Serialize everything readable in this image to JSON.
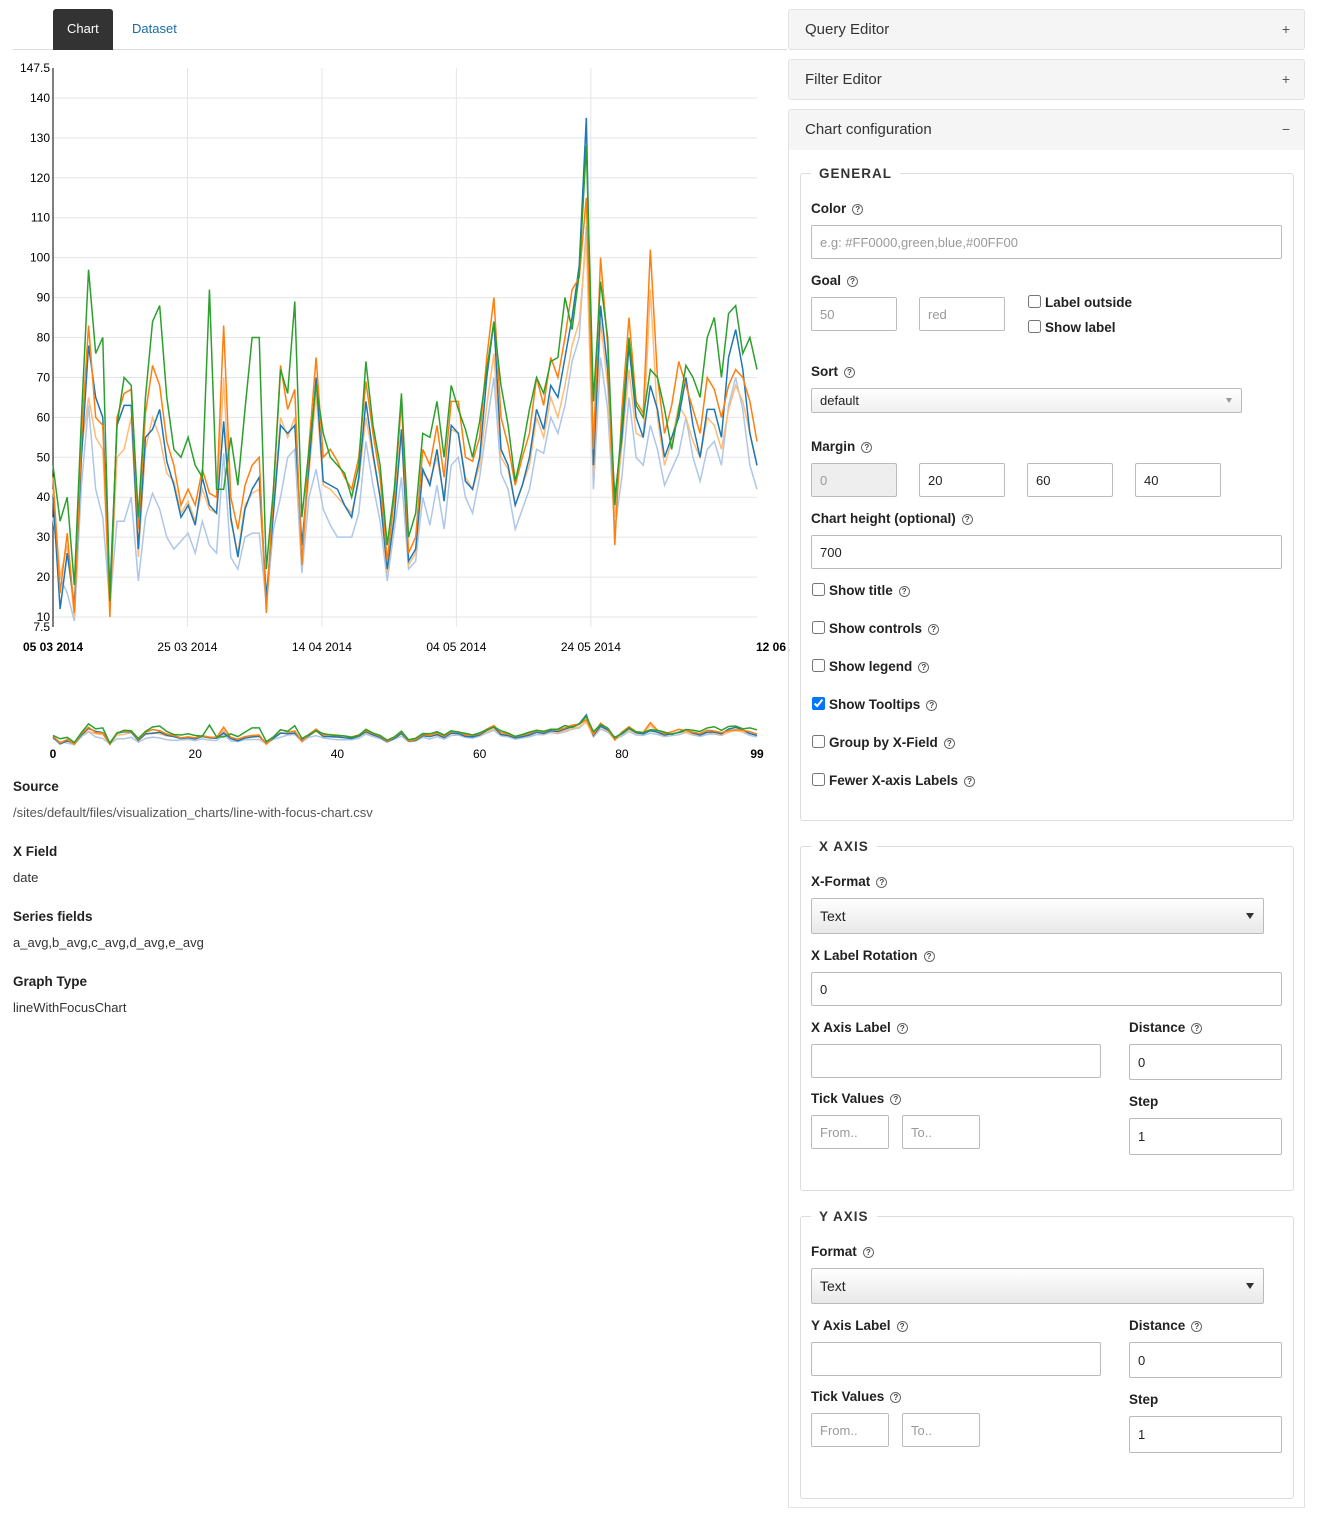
{
  "tabs": [
    {
      "label": "Chart"
    },
    {
      "label": "Dataset"
    }
  ],
  "chart_data": {
    "type": "line",
    "subtype": "lineWithFocusChart",
    "y_ticks": [
      "147.5",
      "140",
      "130",
      "120",
      "110",
      "100",
      "90",
      "80",
      "70",
      "60",
      "50",
      "40",
      "30",
      "20",
      "10",
      "7.5"
    ],
    "x_ticks": [
      "05 03 2014",
      "25 03 2014",
      "14 04 2014",
      "04 05 2014",
      "24 05 2014",
      "12 06 2014"
    ],
    "focus_x_ticks": [
      "0",
      "20",
      "40",
      "60",
      "80",
      "99"
    ],
    "ylim": [
      7.5,
      147.5
    ],
    "x_domain": [
      0,
      99
    ],
    "colors": [
      "#1f77b4",
      "#aec7e8",
      "#ff7f0e",
      "#ffbb78",
      "#2ca02c"
    ],
    "grid": true,
    "series": [
      {
        "values": [
          40,
          12,
          26,
          13,
          50,
          78,
          65,
          60,
          16,
          58,
          63,
          63,
          27,
          55,
          57,
          62,
          49,
          43,
          35,
          38,
          33,
          45,
          38,
          36,
          59,
          35,
          25,
          37,
          42,
          45,
          15,
          36,
          58,
          56,
          58,
          28,
          48,
          70,
          44,
          43,
          42,
          38,
          35,
          45,
          64,
          51,
          40,
          22,
          35,
          57,
          24,
          27,
          47,
          43,
          52,
          39,
          58,
          56,
          44,
          42,
          50,
          70,
          84,
          52,
          48,
          38,
          43,
          50,
          62,
          57,
          68,
          65,
          75,
          85,
          98,
          135,
          48,
          88,
          72,
          40,
          55,
          78,
          60,
          55,
          68,
          62,
          50,
          55,
          60,
          70,
          58,
          50,
          62,
          62,
          55,
          75,
          82,
          72,
          56,
          48
        ]
      },
      {
        "values": [
          35,
          20,
          16,
          9,
          43,
          63,
          42,
          35,
          13,
          34,
          34,
          40,
          19,
          35,
          41,
          37,
          30,
          27,
          29,
          31,
          26,
          34,
          28,
          26,
          51,
          25,
          22,
          30,
          31,
          31,
          13,
          32,
          40,
          50,
          52,
          21,
          40,
          47,
          37,
          33,
          30,
          30,
          30,
          36,
          54,
          43,
          34,
          19,
          32,
          45,
          22,
          24,
          40,
          33,
          43,
          32,
          48,
          50,
          40,
          36,
          45,
          58,
          70,
          46,
          42,
          32,
          37,
          42,
          52,
          51,
          60,
          56,
          63,
          74,
          80,
          108,
          42,
          75,
          62,
          32,
          45,
          65,
          50,
          48,
          58,
          52,
          43,
          47,
          51,
          60,
          50,
          44,
          52,
          54,
          48,
          63,
          70,
          62,
          48,
          42
        ]
      },
      {
        "values": [
          45,
          16,
          31,
          11,
          55,
          83,
          60,
          58,
          10,
          60,
          66,
          67,
          32,
          61,
          73,
          68,
          54,
          48,
          38,
          42,
          38,
          47,
          41,
          40,
          83,
          40,
          32,
          43,
          48,
          50,
          11,
          42,
          73,
          62,
          67,
          23,
          53,
          75,
          50,
          52,
          49,
          45,
          42,
          50,
          69,
          56,
          45,
          24,
          40,
          64,
          26,
          30,
          52,
          48,
          58,
          45,
          64,
          64,
          50,
          49,
          55,
          75,
          90,
          60,
          53,
          43,
          50,
          56,
          70,
          63,
          75,
          70,
          80,
          92,
          95,
          115,
          52,
          100,
          78,
          28,
          62,
          85,
          64,
          61,
          102,
          70,
          56,
          63,
          74,
          68,
          62,
          56,
          70,
          67,
          60,
          68,
          72,
          70,
          64,
          54
        ]
      },
      {
        "values": [
          42,
          20,
          28,
          10,
          52,
          65,
          55,
          52,
          12,
          50,
          52,
          60,
          25,
          52,
          60,
          55,
          46,
          44,
          36,
          39,
          34,
          42,
          37,
          36,
          70,
          34,
          26,
          38,
          41,
          42,
          13,
          38,
          60,
          55,
          60,
          24,
          46,
          66,
          43,
          42,
          40,
          38,
          36,
          44,
          60,
          50,
          40,
          21,
          36,
          56,
          23,
          26,
          46,
          44,
          50,
          40,
          57,
          56,
          45,
          42,
          48,
          63,
          76,
          50,
          47,
          38,
          43,
          48,
          60,
          55,
          65,
          60,
          68,
          78,
          84,
          105,
          46,
          84,
          68,
          35,
          53,
          72,
          56,
          55,
          92,
          60,
          48,
          54,
          63,
          60,
          54,
          50,
          60,
          58,
          52,
          62,
          68,
          64,
          56,
          48
        ]
      },
      {
        "values": [
          48,
          34,
          40,
          18,
          60,
          97,
          76,
          80,
          14,
          58,
          70,
          68,
          35,
          65,
          84,
          88,
          65,
          52,
          50,
          55,
          48,
          45,
          92,
          42,
          42,
          55,
          43,
          62,
          80,
          80,
          22,
          42,
          72,
          66,
          89,
          35,
          52,
          68,
          56,
          50,
          48,
          46,
          40,
          48,
          74,
          58,
          48,
          28,
          42,
          66,
          30,
          36,
          56,
          55,
          64,
          50,
          68,
          62,
          57,
          50,
          59,
          72,
          84,
          68,
          58,
          44,
          52,
          62,
          70,
          66,
          74,
          75,
          90,
          82,
          96,
          128,
          64,
          94,
          80,
          38,
          58,
          80,
          63,
          60,
          72,
          70,
          62,
          52,
          62,
          73,
          70,
          65,
          80,
          85,
          70,
          86,
          88,
          76,
          80,
          72
        ]
      }
    ]
  },
  "meta": {
    "source_label": "Source",
    "source_value": "/sites/default/files/visualization_charts/line-with-focus-chart.csv",
    "xfield_label": "X Field",
    "xfield_value": "date",
    "series_label": "Series fields",
    "series_value": "a_avg,b_avg,c_avg,d_avg,e_avg",
    "graph_label": "Graph Type",
    "graph_value": "lineWithFocusChart"
  },
  "panels": {
    "query_editor": {
      "title": "Query Editor",
      "toggle": "+"
    },
    "filter_editor": {
      "title": "Filter Editor",
      "toggle": "+"
    },
    "chart_config": {
      "title": "Chart configuration",
      "toggle": "−"
    }
  },
  "general": {
    "legend": "GENERAL",
    "color_label": "Color",
    "color_placeholder": "e.g: #FF0000,green,blue,#00FF00",
    "goal_label": "Goal",
    "goal_value_placeholder": "50",
    "goal_color_placeholder": "red",
    "label_outside": "Label outside",
    "show_label": "Show label",
    "sort_label": "Sort",
    "sort_value": "default",
    "margin_label": "Margin",
    "margin_values": [
      "0",
      "20",
      "60",
      "40"
    ],
    "height_label": "Chart height (optional)",
    "height_value": "700",
    "show_title": "Show title",
    "show_controls": "Show controls",
    "show_legend": "Show legend",
    "show_tooltips": "Show Tooltips",
    "group_by_x": "Group by X-Field",
    "fewer_x_labels": "Fewer X-axis Labels"
  },
  "xaxis": {
    "legend": "X AXIS",
    "format_label": "X-Format",
    "format_value": "Text",
    "rotation_label": "X Label Rotation",
    "rotation_value": "0",
    "axis_label": "X Axis Label",
    "axis_label_value": "",
    "distance_label": "Distance",
    "distance_value": "0",
    "tick_values_label": "Tick Values",
    "from_placeholder": "From..",
    "to_placeholder": "To..",
    "step_label": "Step",
    "step_value": "1"
  },
  "yaxis": {
    "legend": "Y AXIS",
    "format_label": "Format",
    "format_value": "Text",
    "axis_label": "Y Axis Label",
    "axis_label_value": "",
    "distance_label": "Distance",
    "distance_value": "0",
    "tick_values_label": "Tick Values",
    "from_placeholder": "From..",
    "to_placeholder": "To..",
    "step_label": "Step",
    "step_value": "1"
  }
}
